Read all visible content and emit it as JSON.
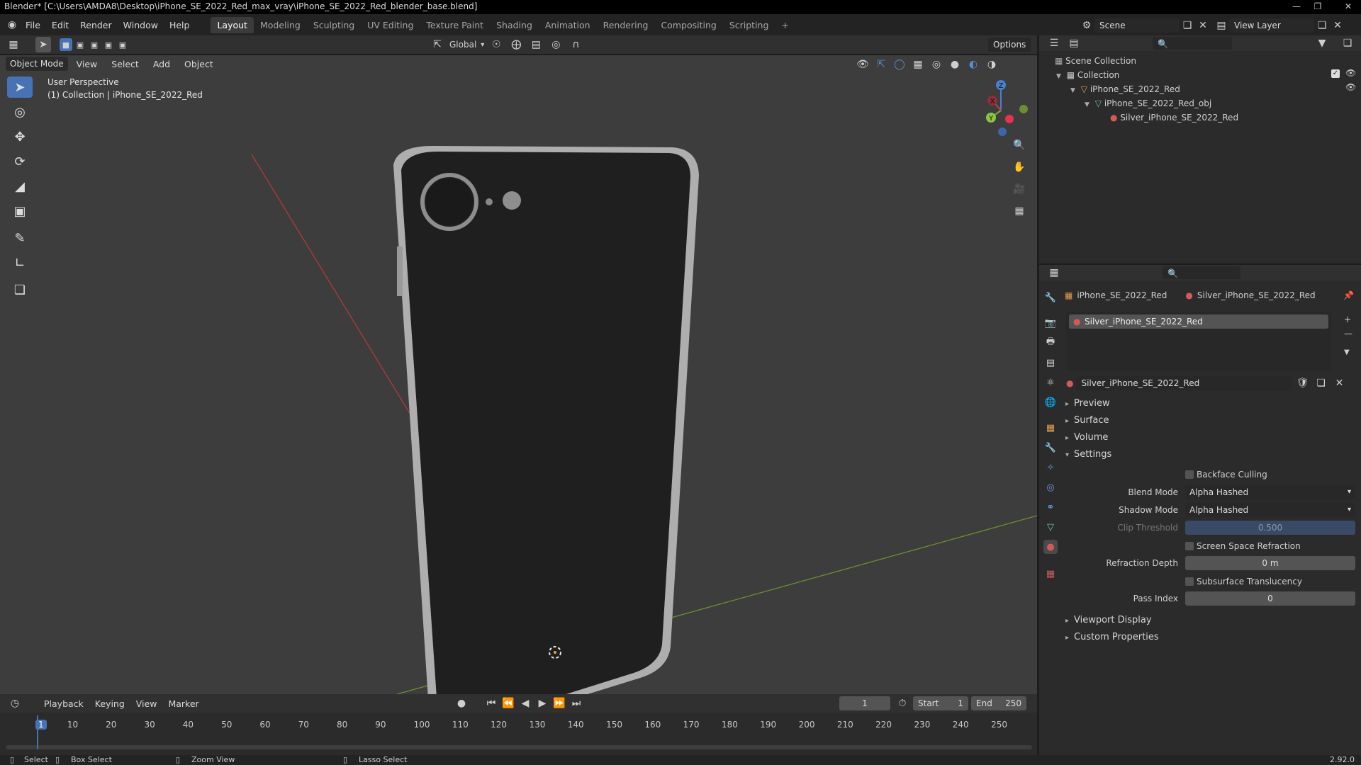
{
  "window_title": "Blender* [C:\\Users\\AMDA8\\Desktop\\iPhone_SE_2022_Red_max_vray\\iPhone_SE_2022_Red_blender_base.blend]",
  "menu": [
    "File",
    "Edit",
    "Render",
    "Window",
    "Help"
  ],
  "workspaces": [
    {
      "label": "Layout",
      "active": true
    },
    {
      "label": "Modeling"
    },
    {
      "label": "Sculpting"
    },
    {
      "label": "UV Editing"
    },
    {
      "label": "Texture Paint"
    },
    {
      "label": "Shading"
    },
    {
      "label": "Animation"
    },
    {
      "label": "Rendering"
    },
    {
      "label": "Compositing"
    },
    {
      "label": "Scripting"
    }
  ],
  "add_workspace": "+",
  "scene": {
    "label": "Scene"
  },
  "view_layer": {
    "label": "View Layer"
  },
  "viewport_header": {
    "mode": "Object Mode",
    "menus": [
      "View",
      "Select",
      "Add",
      "Object"
    ],
    "transform_orientation": "Global",
    "options": "Options"
  },
  "viewport": {
    "perspective": "User Perspective",
    "collection_info": "(1) Collection | iPhone_SE_2022_Red",
    "gizmo_axes": {
      "x": "X",
      "y": "Y",
      "z": "Z"
    }
  },
  "outliner": {
    "root": "Scene Collection",
    "items": [
      {
        "label": "Collection",
        "level": 1
      },
      {
        "label": "iPhone_SE_2022_Red",
        "level": 2
      },
      {
        "label": "iPhone_SE_2022_Red_obj",
        "level": 3
      },
      {
        "label": "Silver_iPhone_SE_2022_Red",
        "level": 4
      }
    ]
  },
  "properties": {
    "breadcrumb_object": "iPhone_SE_2022_Red",
    "breadcrumb_material": "Silver_iPhone_SE_2022_Red",
    "slot_item": "Silver_iPhone_SE_2022_Red",
    "material_name": "Silver_iPhone_SE_2022_Red",
    "sections": {
      "preview": "Preview",
      "surface": "Surface",
      "volume": "Volume",
      "settings": "Settings",
      "viewport_display": "Viewport Display",
      "custom_properties": "Custom Properties"
    },
    "settings": {
      "backface_culling": "Backface Culling",
      "blend_mode_label": "Blend Mode",
      "blend_mode_value": "Alpha Hashed",
      "shadow_mode_label": "Shadow Mode",
      "shadow_mode_value": "Alpha Hashed",
      "clip_threshold_label": "Clip Threshold",
      "clip_threshold_value": "0.500",
      "screen_space_refraction": "Screen Space Refraction",
      "refraction_depth_label": "Refraction Depth",
      "refraction_depth_value": "0 m",
      "subsurface_translucency": "Subsurface Translucency",
      "pass_index_label": "Pass Index",
      "pass_index_value": "0"
    }
  },
  "timeline": {
    "menus": [
      "Playback",
      "Keying",
      "View",
      "Marker"
    ],
    "current_frame": "1",
    "start_label": "Start",
    "start_value": "1",
    "end_label": "End",
    "end_value": "250",
    "ticks": [
      "1",
      "10",
      "20",
      "30",
      "40",
      "50",
      "60",
      "70",
      "80",
      "90",
      "100",
      "110",
      "120",
      "130",
      "140",
      "150",
      "160",
      "170",
      "180",
      "190",
      "200",
      "210",
      "220",
      "230",
      "240",
      "250"
    ]
  },
  "statusbar": {
    "select": "Select",
    "box_select": "Box Select",
    "zoom_view": "Zoom View",
    "lasso_select": "Lasso Select",
    "version": "2.92.0"
  },
  "colors": {
    "accent": "#4772b3",
    "viewport_bg": "#3d3d3d",
    "panel_bg": "#2b2b2b",
    "axis_x": "#c73a3a",
    "axis_y": "#6e9b2e",
    "phone_body": "#1f1f1f",
    "phone_frame": "#b8b8b8"
  }
}
